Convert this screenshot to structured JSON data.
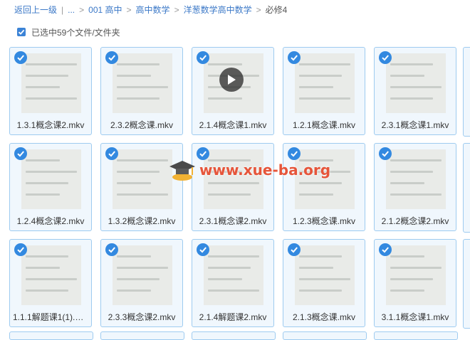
{
  "breadcrumb": {
    "back": "返回上一级",
    "ellipsis": "...",
    "items": [
      "001 高中",
      "高中数学",
      "洋葱数学高中数学"
    ],
    "current": "必修4"
  },
  "selection": {
    "text": "已选中59个文件/文件夹"
  },
  "accent_color": "#3389e0",
  "files": [
    {
      "name": "1.3.1概念课2.mkv"
    },
    {
      "name": "2.3.2概念课.mkv"
    },
    {
      "name": "2.1.4概念课1.mkv"
    },
    {
      "name": "1.2.1概念课.mkv"
    },
    {
      "name": "2.3.1概念课1.mkv"
    },
    {
      "name": "1.2.4概念课2.mkv"
    },
    {
      "name": "1.3.2概念课2.mkv"
    },
    {
      "name": "2.3.1概念课2.mkv"
    },
    {
      "name": "1.2.3概念课.mkv"
    },
    {
      "name": "2.1.2概念课2.mkv"
    },
    {
      "name": "1.1.1解题课1(1).m..."
    },
    {
      "name": "2.3.3概念课2.mkv"
    },
    {
      "name": "2.1.4解题课2.mkv"
    },
    {
      "name": "2.1.3概念课.mkv"
    },
    {
      "name": "3.1.1概念课1.mkv"
    }
  ],
  "watermark": {
    "text": "www.xue-ba.org",
    "icon": "graduation-cap-icon"
  },
  "play_icon": "play-icon"
}
